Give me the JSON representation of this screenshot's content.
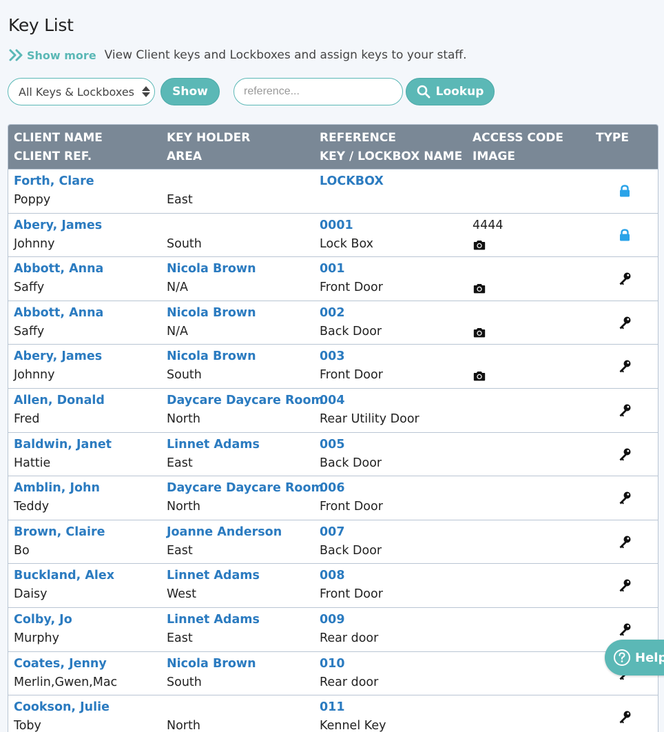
{
  "page": {
    "title": "Key List",
    "show_more": "Show more",
    "description": "View Client keys and Lockboxes and assign keys to your staff."
  },
  "controls": {
    "filter_value": "All Keys & Lockboxes",
    "show_label": "Show",
    "reference_placeholder": "reference...",
    "lookup_label": "Lookup"
  },
  "table": {
    "headers": {
      "col1_line1": "CLIENT NAME",
      "col1_line2": "CLIENT REF.",
      "col2_line1": "KEY HOLDER",
      "col2_line2": "AREA",
      "col3_line1": "REFERENCE",
      "col3_line2": "KEY / LOCKBOX NAME",
      "col4_line1": "ACCESS CODE",
      "col4_line2": "IMAGE",
      "col5_line1": "TYPE"
    },
    "rows": [
      {
        "client_name": "Forth, Clare",
        "client_ref": "Poppy",
        "key_holder": "",
        "area": "East",
        "reference": "LOCKBOX",
        "key_name": "",
        "access_code": "",
        "image": false,
        "type": "lockbox"
      },
      {
        "client_name": "Abery, James",
        "client_ref": "Johnny",
        "key_holder": "",
        "area": "South",
        "reference": "0001",
        "key_name": "Lock Box",
        "access_code": "4444",
        "image": true,
        "type": "lockbox"
      },
      {
        "client_name": "Abbott, Anna",
        "client_ref": "Saffy",
        "key_holder": "Nicola Brown",
        "area": "N/A",
        "reference": "001",
        "key_name": "Front Door",
        "access_code": "",
        "image": true,
        "type": "key"
      },
      {
        "client_name": "Abbott, Anna",
        "client_ref": "Saffy",
        "key_holder": "Nicola Brown",
        "area": "N/A",
        "reference": "002",
        "key_name": "Back Door",
        "access_code": "",
        "image": true,
        "type": "key"
      },
      {
        "client_name": "Abery, James",
        "client_ref": "Johnny",
        "key_holder": "Nicola Brown",
        "area": "South",
        "reference": "003",
        "key_name": "Front Door",
        "access_code": "",
        "image": true,
        "type": "key"
      },
      {
        "client_name": "Allen, Donald",
        "client_ref": "Fred",
        "key_holder": "Daycare Daycare Room",
        "area": "North",
        "reference": "004",
        "key_name": "Rear Utility Door",
        "access_code": "",
        "image": false,
        "type": "key"
      },
      {
        "client_name": "Baldwin, Janet",
        "client_ref": "Hattie",
        "key_holder": "Linnet Adams",
        "area": "East",
        "reference": "005",
        "key_name": "Back Door",
        "access_code": "",
        "image": false,
        "type": "key"
      },
      {
        "client_name": "Amblin, John",
        "client_ref": "Teddy",
        "key_holder": "Daycare Daycare Room",
        "area": "North",
        "reference": "006",
        "key_name": "Front Door",
        "access_code": "",
        "image": false,
        "type": "key"
      },
      {
        "client_name": "Brown, Claire",
        "client_ref": "Bo",
        "key_holder": "Joanne Anderson",
        "area": "East",
        "reference": "007",
        "key_name": "Back Door",
        "access_code": "",
        "image": false,
        "type": "key"
      },
      {
        "client_name": "Buckland, Alex",
        "client_ref": "Daisy",
        "key_holder": "Linnet Adams",
        "area": "West",
        "reference": "008",
        "key_name": "Front Door",
        "access_code": "",
        "image": false,
        "type": "key"
      },
      {
        "client_name": "Colby, Jo",
        "client_ref": "Murphy",
        "key_holder": "Linnet Adams",
        "area": "East",
        "reference": "009",
        "key_name": "Rear door",
        "access_code": "",
        "image": false,
        "type": "key"
      },
      {
        "client_name": "Coates, Jenny",
        "client_ref": "Merlin,Gwen,Mac",
        "key_holder": "Nicola Brown",
        "area": "South",
        "reference": "010",
        "key_name": "Rear door",
        "access_code": "",
        "image": false,
        "type": "key"
      },
      {
        "client_name": "Cookson, Julie",
        "client_ref": "Toby",
        "key_holder": "",
        "area": "North",
        "reference": "011",
        "key_name": "Kennel Key",
        "access_code": "",
        "image": false,
        "type": "key"
      }
    ]
  },
  "help": {
    "label": "Help"
  },
  "colors": {
    "accent": "#5bb8b6",
    "link": "#2b7bc0",
    "header_bg": "#7a8896",
    "lock_blue": "#2aa3e8"
  }
}
